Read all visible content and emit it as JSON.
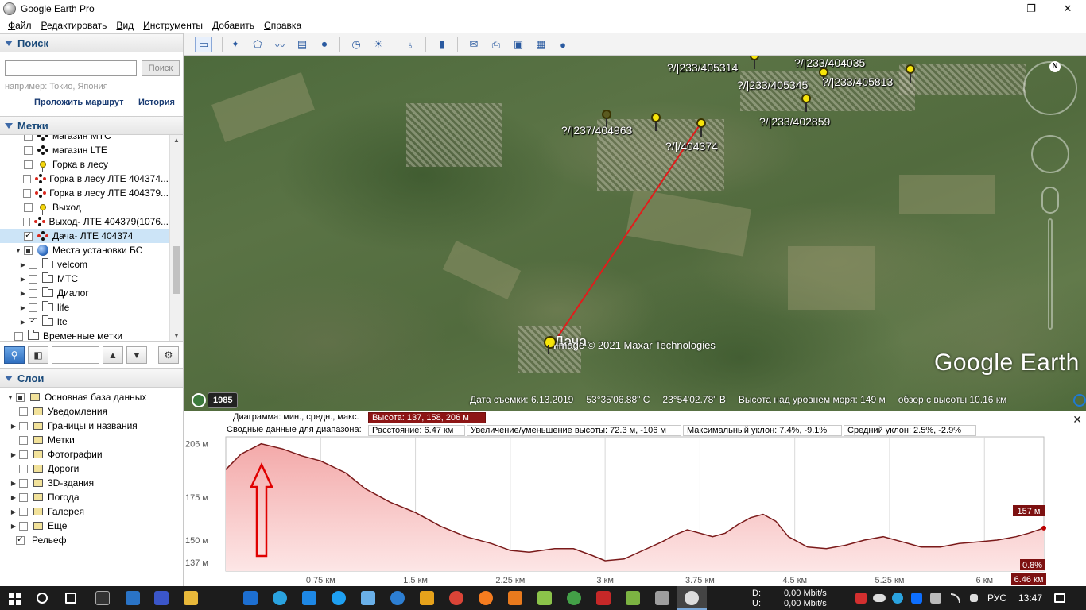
{
  "window": {
    "title": "Google Earth Pro",
    "minimize": "—",
    "maximize": "❐",
    "close": "✕"
  },
  "menu": [
    "Файл",
    "Редактировать",
    "Вид",
    "Инструменты",
    "Добавить",
    "Справка"
  ],
  "search": {
    "header": "Поиск",
    "placeholder": "",
    "button": "Поиск",
    "hint": "например: Токио, Япония",
    "route_link": "Проложить маршрут",
    "history_link": "История"
  },
  "places": {
    "header": "Метки",
    "items": [
      {
        "label": "магазин МТС",
        "checked": false,
        "icon": "multi-point-icon",
        "indent": 0
      },
      {
        "label": "магазин LTE",
        "checked": false,
        "icon": "multi-point-icon",
        "indent": 0
      },
      {
        "label": "Горка в лесу",
        "checked": false,
        "icon": "yellow-pin-icon",
        "indent": 0
      },
      {
        "label": "Горка в лесу ЛТЕ 404374...",
        "checked": false,
        "icon": "red-path-icon",
        "indent": 0
      },
      {
        "label": "Горка в лесу ЛТЕ 404379...",
        "checked": false,
        "icon": "red-path-icon",
        "indent": 0
      },
      {
        "label": "Выход",
        "checked": false,
        "icon": "yellow-pin-icon",
        "indent": 0
      },
      {
        "label": "Выход- ЛТЕ 404379(1076...",
        "checked": false,
        "icon": "red-path-icon",
        "indent": 0
      },
      {
        "label": "Дача- ЛТЕ 404374",
        "checked": true,
        "icon": "red-path-icon",
        "indent": 0,
        "selected": true
      },
      {
        "label": "Места установки БС",
        "checked": "partial",
        "icon": "globe-icon",
        "indent": 0,
        "expanded": true
      },
      {
        "label": "velcom",
        "checked": false,
        "icon": "folder-icon",
        "indent": 1,
        "collapsed": true
      },
      {
        "label": "МТС",
        "checked": false,
        "icon": "folder-icon",
        "indent": 1,
        "collapsed": true
      },
      {
        "label": "Диалог",
        "checked": false,
        "icon": "folder-icon",
        "indent": 1,
        "collapsed": true
      },
      {
        "label": "life",
        "checked": false,
        "icon": "folder-icon",
        "indent": 1,
        "collapsed": true
      },
      {
        "label": "lte",
        "checked": true,
        "icon": "folder-icon",
        "indent": 1,
        "collapsed": true
      },
      {
        "label": "Временные метки",
        "checked": false,
        "icon": "folder-icon",
        "indent": -1
      }
    ]
  },
  "layers": {
    "header": "Слои",
    "items": [
      {
        "label": "Основная база данных",
        "checked": "partial",
        "icon": "layers-icon",
        "expander": "down"
      },
      {
        "label": "Уведомления",
        "checked": false,
        "icon": "envelope-icon",
        "expander": ""
      },
      {
        "label": "Границы и названия",
        "checked": false,
        "icon": "flag-icon",
        "expander": "right"
      },
      {
        "label": "Метки",
        "checked": false,
        "icon": "square-icon",
        "expander": ""
      },
      {
        "label": "Фотографии",
        "checked": false,
        "icon": "photo-icon",
        "expander": "right"
      },
      {
        "label": "Дороги",
        "checked": false,
        "icon": "road-icon",
        "expander": ""
      },
      {
        "label": "3D-здания",
        "checked": false,
        "icon": "building-icon",
        "expander": "right"
      },
      {
        "label": "Погода",
        "checked": false,
        "icon": "sun-icon",
        "expander": "right"
      },
      {
        "label": "Галерея",
        "checked": false,
        "icon": "star-icon",
        "expander": "right"
      },
      {
        "label": "Еще",
        "checked": false,
        "icon": "square-icon",
        "expander": "right"
      },
      {
        "label": "Рельеф",
        "checked": true,
        "icon": "",
        "expander": ""
      }
    ]
  },
  "map": {
    "labels": [
      {
        "text": "?/|233/405314"
      },
      {
        "text": "?/|233/404035"
      },
      {
        "text": "?/|233/405345"
      },
      {
        "text": "?/|233/405813"
      },
      {
        "text": "?/|233/402859"
      },
      {
        "text": "?/|237/404963"
      },
      {
        "text": "?/|/404374"
      }
    ],
    "dacha_label": "Дача",
    "copyright": "Image © 2021 Maxar Technologies",
    "logo": "Google Earth",
    "compass_n": "N",
    "history_year": "1985",
    "status": {
      "date": "Дата съемки: 6.13.2019",
      "lat": "53°35'06.88\" С",
      "lon": "23°54'02.78\" В",
      "elevation": "Высота над уровнем моря:    149 м",
      "eye": "обзор с высоты   10.16 км"
    }
  },
  "profile": {
    "row1_label": "Диаграмма: мин., средн., макс.",
    "row1_value": "Высота: 137, 158, 206 м",
    "row2_label": "Сводные данные для диапазона:",
    "distance": "Расстояние: 6.47 км",
    "gain_loss": "Увеличение/уменьшение высоты: 72.3 м, -106 м",
    "max_slope": "Максимальный уклон: 7.4%, -9.1%",
    "avg_slope": "Средний уклон: 2.5%, -2.9%",
    "close": "✕",
    "current_value": "157 м",
    "current_slope": "0.8%",
    "current_distance": "6.46 км"
  },
  "chart_data": {
    "type": "area",
    "title": "",
    "xlabel": "",
    "ylabel": "",
    "y_ticks": [
      "206 м",
      "175 м",
      "150 м",
      "137 м"
    ],
    "y_tick_values": [
      206,
      175,
      150,
      137
    ],
    "x_ticks": [
      "0.75 км",
      "1.5 км",
      "2.25 км",
      "3 км",
      "3.75 км",
      "4.5 км",
      "5.25 км",
      "6 км"
    ],
    "x_tick_values": [
      0.75,
      1.5,
      2.25,
      3,
      3.75,
      4.5,
      5.25,
      6
    ],
    "xlim": [
      0,
      6.47
    ],
    "ylim": [
      132,
      210
    ],
    "series": [
      {
        "name": "",
        "color": "#7a1a1a",
        "fill": "#f7c7c7",
        "x": [
          0,
          0.12,
          0.28,
          0.45,
          0.6,
          0.75,
          0.95,
          1.1,
          1.3,
          1.5,
          1.7,
          1.9,
          2.1,
          2.25,
          2.4,
          2.6,
          2.75,
          2.9,
          3.0,
          3.15,
          3.3,
          3.45,
          3.55,
          3.65,
          3.75,
          3.85,
          3.95,
          4.05,
          4.15,
          4.25,
          4.35,
          4.45,
          4.6,
          4.75,
          4.9,
          5.05,
          5.2,
          5.35,
          5.5,
          5.65,
          5.8,
          5.95,
          6.1,
          6.25,
          6.35,
          6.47
        ],
        "y": [
          191,
          200,
          206,
          203,
          199,
          196,
          189,
          180,
          172,
          166,
          158,
          152,
          148,
          144,
          143,
          145,
          145,
          141,
          138,
          139,
          144,
          149,
          153,
          156,
          154,
          152,
          154,
          159,
          163,
          165,
          161,
          152,
          146,
          145,
          147,
          150,
          152,
          149,
          146,
          146,
          148,
          149,
          150,
          152,
          154,
          157
        ]
      }
    ]
  },
  "taskbar": {
    "net_label_down": "D:",
    "net_label_up": "U:",
    "net_down": "0,00 Mbit/s",
    "net_up": "0,00 Mbit/s",
    "lang": "РУС",
    "time": "13:47"
  },
  "colors": {
    "accent": "#3e6aa8",
    "path": "#e31b1b",
    "profile_hl": "#8d1515"
  }
}
